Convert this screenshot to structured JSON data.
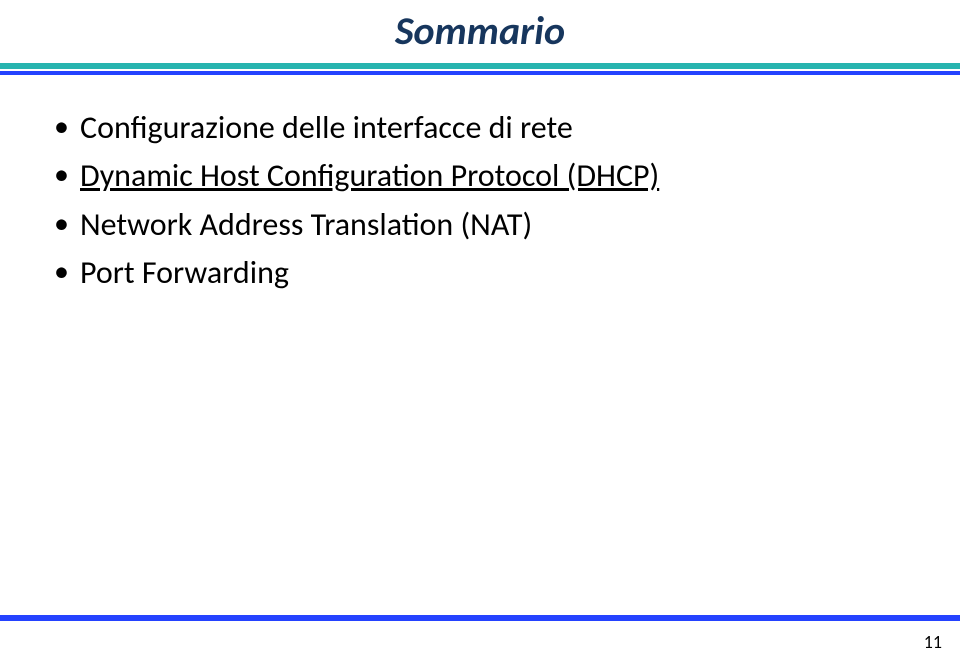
{
  "title": "Sommario",
  "bullets": [
    {
      "text": "Configurazione delle interfacce di rete",
      "underline": false
    },
    {
      "text": "Dynamic Host Configuration Protocol (DHCP)",
      "underline": true
    },
    {
      "text": "Network Address Translation (NAT)",
      "underline": false
    },
    {
      "text": "Port Forwarding",
      "underline": false
    }
  ],
  "page_number": "11"
}
